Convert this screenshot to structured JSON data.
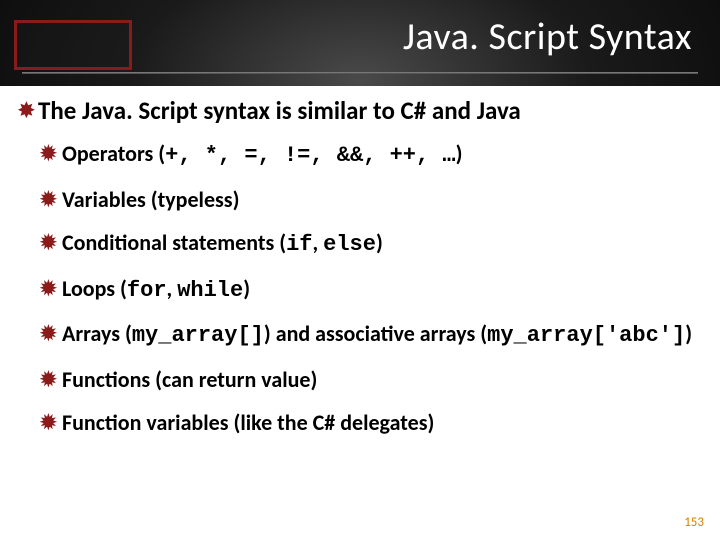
{
  "title": "Java. Script Syntax",
  "main": {
    "bullet_glyph": "✸",
    "text": "The Java. Script syntax is similar to C# and Java"
  },
  "subs": [
    {
      "pre": "Operators (",
      "mono": "+, *, =, !=, &&, ++, …",
      "post": ")"
    },
    {
      "pre": "Variables (typeless)",
      "mono": "",
      "post": ""
    },
    {
      "pre": "Conditional statements (",
      "mono": "if",
      "mid": ", ",
      "mono2": "else",
      "post": ")"
    },
    {
      "pre": "Loops (",
      "mono": "for",
      "mid": ", ",
      "mono2": "while",
      "post": ")"
    },
    {
      "pre": "Arrays (",
      "mono": "my_array[]",
      "mid": ") and associative arrays (",
      "mono2": "my_array['abc']",
      "post": ")"
    },
    {
      "pre": "Functions (can return value)",
      "mono": "",
      "post": ""
    },
    {
      "pre": "Function variables (like the C# delegates)",
      "mono": "",
      "post": ""
    }
  ],
  "sub_glyph": "✹",
  "page_number": "153"
}
